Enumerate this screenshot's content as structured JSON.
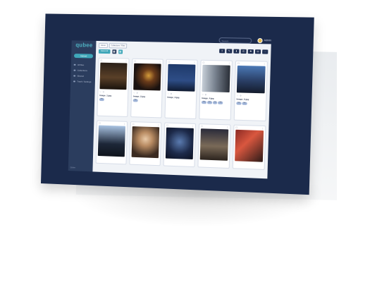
{
  "app": {
    "logo": "qubee",
    "new_button": "Upload",
    "search_placeholder": "Search",
    "user_name": "Admin"
  },
  "sidebar": {
    "items": [
      {
        "label": "All files"
      },
      {
        "label": "Collections"
      },
      {
        "label": "Shared"
      },
      {
        "label": "Trash / Settings"
      }
    ],
    "footer": "Qubee"
  },
  "breadcrumbs": [
    "Home",
    "Collections / Files"
  ],
  "toolbar": {
    "primary": "Select All",
    "view_grid": "▦",
    "view_list": "▤",
    "tools": [
      "⇪",
      "✎",
      "⬇",
      "⎘",
      "⚑",
      "✉",
      "⋯"
    ]
  },
  "cards": [
    {
      "meta": [
        "♡",
        "0"
      ],
      "name": "Image_1.jpg",
      "tags": [
        "tag"
      ],
      "short": false
    },
    {
      "meta": [
        "♡",
        "0"
      ],
      "name": "Image_2.jpg",
      "tags": [
        "tag"
      ],
      "short": false
    },
    {
      "meta": [
        "♡",
        "0"
      ],
      "name": "Image_3.jpg",
      "tags": [],
      "short": false
    },
    {
      "meta": [
        "♡",
        "0"
      ],
      "name": "Image_4.jpg",
      "tags": [
        "tag",
        "tag",
        "tag",
        "tag"
      ],
      "short": false
    },
    {
      "meta": [
        "♡",
        "0"
      ],
      "name": "Image_5.jpg",
      "tags": [
        "tag",
        "tag"
      ],
      "short": false
    },
    {
      "meta": [],
      "name": "",
      "tags": [],
      "short": true
    },
    {
      "meta": [],
      "name": "",
      "tags": [],
      "short": true
    },
    {
      "meta": [],
      "name": "",
      "tags": [],
      "short": true
    },
    {
      "meta": [],
      "name": "",
      "tags": [],
      "short": true
    },
    {
      "meta": [],
      "name": "",
      "tags": [],
      "short": true
    }
  ]
}
